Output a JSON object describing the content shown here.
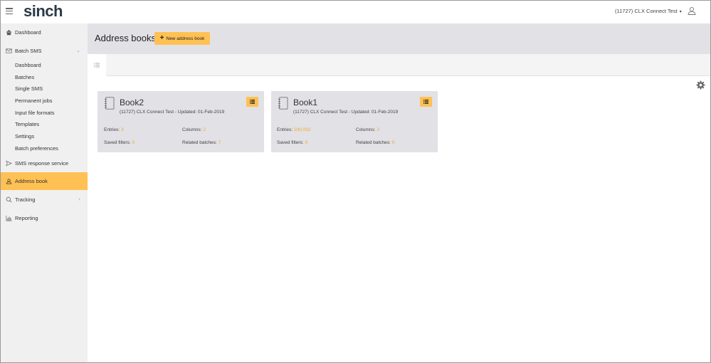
{
  "header": {
    "logo": "sinch",
    "account": "(11727) CLX Connect Test"
  },
  "sidebar": {
    "items": [
      {
        "label": "Dashboard"
      },
      {
        "label": "Batch SMS"
      },
      {
        "label": "SMS response service"
      },
      {
        "label": "Address book"
      },
      {
        "label": "Tracking"
      },
      {
        "label": "Reporting"
      }
    ],
    "batch_sms_children": [
      "Dashboard",
      "Batches",
      "Single SMS",
      "Permanent jobs",
      "Input file formats",
      "Templates",
      "Settings",
      "Batch preferences"
    ]
  },
  "main": {
    "title": "Address books",
    "new_button": "New address book"
  },
  "cards": [
    {
      "title": "Book2",
      "subtitle": "(11727) CLX Connect Test - Updated: 01-Feb-2019",
      "entries_label": "Entries:",
      "entries": "3",
      "columns_label": "Columns:",
      "columns": "2",
      "filters_label": "Saved filters:",
      "filters": "0",
      "batches_label": "Related batches:",
      "batches": "7"
    },
    {
      "title": "Book1",
      "subtitle": "(11727) CLX Connect Test - Updated: 01-Feb-2019",
      "entries_label": "Entries:",
      "entries": "200,002",
      "columns_label": "Columns:",
      "columns": "2",
      "filters_label": "Saved filters:",
      "filters": "0",
      "batches_label": "Related batches:",
      "batches": "0"
    }
  ],
  "colors": {
    "accent": "#ffc153",
    "value": "#f5a623",
    "sidebar_bg": "#f0f0f0",
    "header_bg": "#e2e2e6"
  }
}
